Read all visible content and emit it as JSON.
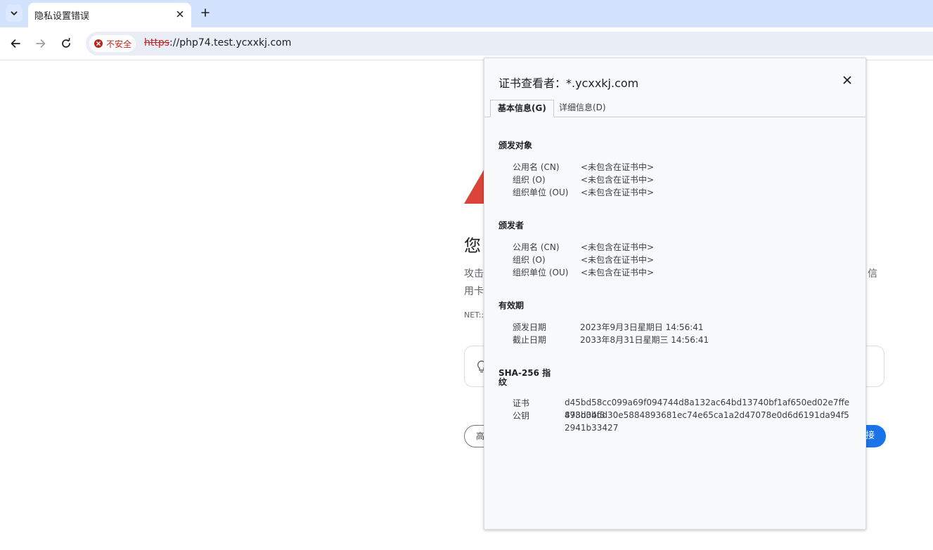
{
  "browser": {
    "tab_title": "隐私设置错误",
    "security_chip_label": "不安全",
    "url_scheme": "https",
    "url_rest": "://php74.test.ycxxkj.com"
  },
  "background_page": {
    "heading_visible": "您",
    "body_line1_start": "攻击",
    "body_line1_end": "信",
    "body_line2_start": "用卡",
    "error_code_start": "NET::",
    "advanced_button_start": "高",
    "back_button_end": "接",
    "warning_color": "#db4437"
  },
  "cert_viewer": {
    "title": "证书查看者：*.ycxxkj.com",
    "tabs": [
      {
        "label": "基本信息(G)",
        "active": true
      },
      {
        "label": "详细信息(D)",
        "active": false
      }
    ],
    "issued_to": {
      "title": "颁发对象",
      "rows": [
        {
          "label": "公用名 (CN)",
          "value": "<未包含在证书中>"
        },
        {
          "label": "组织 (O)",
          "value": "<未包含在证书中>"
        },
        {
          "label": "组织单位 (OU)",
          "value": "<未包含在证书中>"
        }
      ]
    },
    "issued_by": {
      "title": "颁发者",
      "rows": [
        {
          "label": "公用名 (CN)",
          "value": "<未包含在证书中>"
        },
        {
          "label": "组织 (O)",
          "value": "<未包含在证书中>"
        },
        {
          "label": "组织单位 (OU)",
          "value": "<未包含在证书中>"
        }
      ]
    },
    "validity": {
      "title": "有效期",
      "rows": [
        {
          "label": "颁发日期",
          "value": "2023年9月3日星期日 14:56:41"
        },
        {
          "label": "截止日期",
          "value": "2033年8月31日星期三 14:56:41"
        }
      ]
    },
    "fingerprints": {
      "title_line1": "SHA-256 指",
      "title_line2": "纹",
      "rows": [
        {
          "label": "证书",
          "value": "d45bd58cc099a69f094744d8a132ac64bd13740bf1af650ed02e7ffe893d04f3"
        },
        {
          "label": "公钥",
          "value": "478b3bdd30e5884893681ec74e65ca1a2d47078e0d6d6191da94f52941b33427"
        }
      ]
    }
  }
}
